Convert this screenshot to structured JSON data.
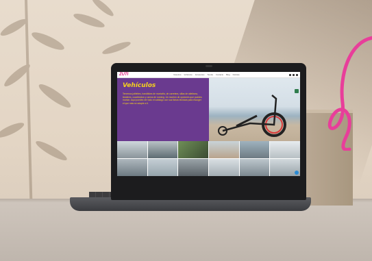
{
  "website": {
    "logo_text": "ZUTI",
    "url_text": "",
    "menu": [
      "Nosotros",
      "Vehículos",
      "Accesorios",
      "Tienda",
      "Contacto",
      "Blog",
      "Noticias"
    ],
    "hero_title": "Vehículos",
    "hero_text": "Tenemos joëlettes, handbikes de montaña, de carretera, sillas de atletismo, tándems, cuadriciclos y carros de running. Un montón de opciones que puedes montar. Aquí puedes ver todo el catálogo con sus fichas técnicas para escoger el que más se adapte a ti."
  },
  "colors": {
    "hero_background": "#6a3a8f",
    "hero_text": "#f5d21c",
    "brand_pink": "#e0197d",
    "squiggle": "#e83e9a"
  },
  "icons": [
    "chat-icon",
    "messenger-icon"
  ]
}
